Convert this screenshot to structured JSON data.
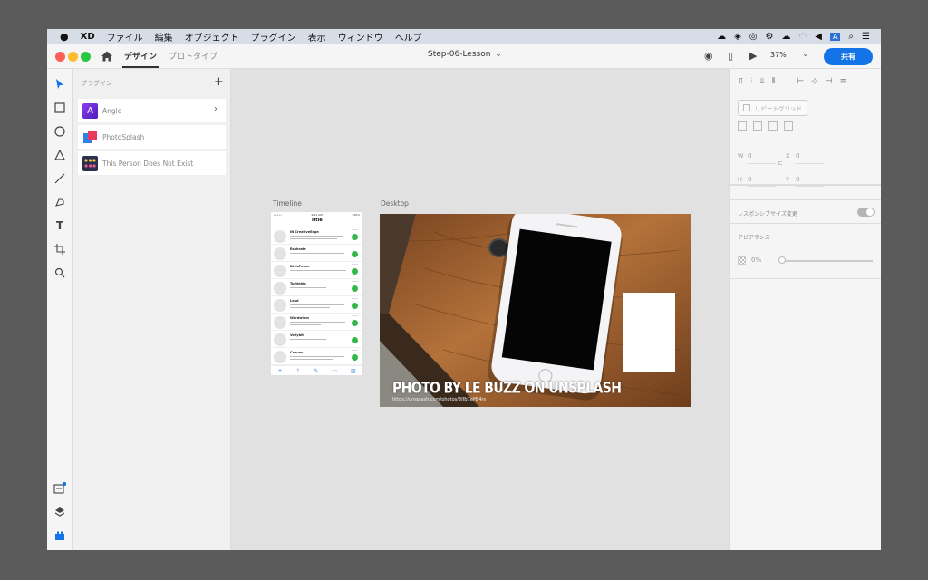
{
  "menubar": {
    "apple": "",
    "app": "XD",
    "items": [
      "ファイル",
      "編集",
      "オブジェクト",
      "プラグイン",
      "表示",
      "ウィンドウ",
      "ヘルプ"
    ],
    "status_icons": [
      "creative-cloud-sync-icon",
      "dropbox-icon",
      "creative-cloud-icon",
      "gear-badge-icon",
      "upload-cloud-icon",
      "wifi-icon",
      "volume-icon",
      "input-a-icon",
      "search-icon",
      "list-icon"
    ]
  },
  "titlebar": {
    "tabs": [
      {
        "label": "デザイン",
        "active": true
      },
      {
        "label": "プロトタイプ",
        "active": false
      }
    ],
    "doc_title": "Step-06-Lesson",
    "zoom": "37%",
    "share": "共有"
  },
  "tools": [
    "select-tool",
    "rectangle-tool",
    "ellipse-tool",
    "polygon-tool",
    "line-tool",
    "pen-tool",
    "text-tool",
    "artboard-tool",
    "zoom-tool"
  ],
  "plugins_panel": {
    "header": "プラグイン",
    "items": [
      {
        "name": "Angle",
        "icon": "A",
        "color": "#6b2fd6"
      },
      {
        "name": "PhotoSplash",
        "icon": "",
        "color": "#2f80ed"
      },
      {
        "name": "This Person Does Not Exist",
        "icon": "",
        "color": "#2a2f4e"
      }
    ]
  },
  "artboards": {
    "timeline": {
      "label": "Timeline",
      "status_left": "•••••",
      "status_mid": "9:41 AM",
      "status_right": "100%",
      "title": "Title",
      "rows": [
        "IN CreativeEdge",
        "Esphrate",
        "DivisPower",
        "Turtlebig",
        "Lead",
        "Wardwinm",
        "Vellybit",
        "Canvas"
      ]
    },
    "desktop": {
      "label": "Desktop",
      "credit": "PHOTO BY LE BUZZ ON UNSPLASH",
      "url": "https://unsplash.com/photos/3Ifb7ePB4rs"
    }
  },
  "inspector": {
    "repeat_grid": "リピートグリッド",
    "w_label": "W",
    "w_value": "0",
    "h_label": "H",
    "h_value": "0",
    "x_label": "X",
    "x_value": "0",
    "y_label": "Y",
    "y_value": "0",
    "responsive_label": "レスポンシブサイズ変更",
    "appearance_label": "アピアランス",
    "opacity_value": "0%",
    "opacity_fraction": 0
  }
}
